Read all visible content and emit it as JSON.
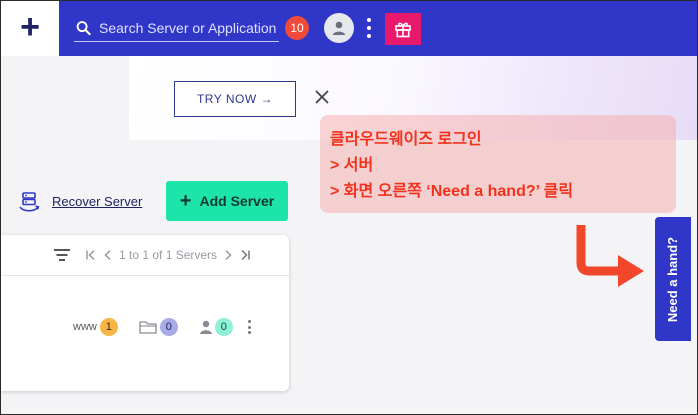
{
  "topbar": {
    "add_symbol": "+",
    "search_placeholder": "Search Server or Application",
    "notification_count": "10",
    "icons": [
      "plus-icon",
      "search-icon",
      "user-icon",
      "kebab-icon",
      "gift-icon"
    ],
    "colors": {
      "bar": "#2f36c8",
      "gift": "#e8196b",
      "badge": "#f04a3b"
    }
  },
  "banner": {
    "try_now_label": "TRY NOW →"
  },
  "toolbar": {
    "recover_label": "Recover Server",
    "add_label": "Add Server",
    "add_symbol": "+",
    "add_color": "#1de4a8"
  },
  "servers": {
    "pager_text": "1 to 1 of 1 Servers",
    "row": {
      "www_label": "www",
      "www_count": "1",
      "folder_count": "0",
      "user_count": "0"
    }
  },
  "annotation": {
    "line1": "클라우드웨이즈 로그인",
    "line2": "> 서버",
    "line3": "> 화면 오른쪽  ‘Need a hand?’  클릭",
    "color": "#f2321c"
  },
  "help_tab": {
    "label": "Need a hand?"
  }
}
